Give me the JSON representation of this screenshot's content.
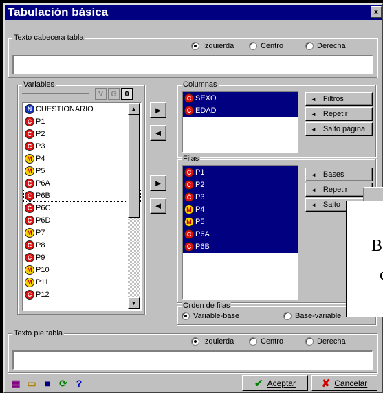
{
  "window": {
    "title": "Tabulación básica",
    "close": "x"
  },
  "header_group": {
    "label": "Texto cabecera tabla",
    "value": "",
    "align": [
      {
        "label": "Izquierda",
        "checked": true
      },
      {
        "label": "Centro",
        "checked": false
      },
      {
        "label": "Derecha",
        "checked": false
      }
    ]
  },
  "variables": {
    "label": "Variables",
    "filter_buttons": [
      {
        "label": "V",
        "active": false
      },
      {
        "label": "G",
        "active": false
      },
      {
        "label": "0",
        "active": true
      }
    ],
    "items": [
      {
        "badge": "N",
        "name": "CUESTIONARIO"
      },
      {
        "badge": "C",
        "name": "P1"
      },
      {
        "badge": "C",
        "name": "P2"
      },
      {
        "badge": "C",
        "name": "P3"
      },
      {
        "badge": "M",
        "name": "P4"
      },
      {
        "badge": "M",
        "name": "P5"
      },
      {
        "badge": "C",
        "name": "P6A"
      },
      {
        "badge": "C",
        "name": "P6B"
      },
      {
        "badge": "C",
        "name": "P6C"
      },
      {
        "badge": "C",
        "name": "P6D"
      },
      {
        "badge": "M",
        "name": "P7"
      },
      {
        "badge": "C",
        "name": "P8"
      },
      {
        "badge": "C",
        "name": "P9"
      },
      {
        "badge": "M",
        "name": "P10"
      },
      {
        "badge": "M",
        "name": "P11"
      },
      {
        "badge": "C",
        "name": "P12"
      }
    ]
  },
  "move_icons": {
    "right": "►",
    "left": "◄"
  },
  "columns": {
    "label": "Columnas",
    "items": [
      {
        "badge": "C",
        "name": "SEXO"
      },
      {
        "badge": "C",
        "name": "EDAD"
      }
    ],
    "buttons": [
      "Filtros",
      "Repetir",
      "Salto página"
    ]
  },
  "rows": {
    "label": "Filas",
    "items": [
      {
        "badge": "C",
        "name": "P1"
      },
      {
        "badge": "C",
        "name": "P2"
      },
      {
        "badge": "C",
        "name": "P3"
      },
      {
        "badge": "M",
        "name": "P4"
      },
      {
        "badge": "M",
        "name": "P5"
      },
      {
        "badge": "C",
        "name": "P6A"
      },
      {
        "badge": "C",
        "name": "P6B"
      }
    ],
    "buttons": [
      "Bases",
      "Repetir",
      "Salto"
    ]
  },
  "row_order": {
    "label": "Orden de filas",
    "options": [
      {
        "label": "Variable-base",
        "checked": true
      },
      {
        "label": "Base-variable",
        "checked": false
      }
    ]
  },
  "footer_group": {
    "label": "Texto pie tabla",
    "value": "",
    "align": [
      {
        "label": "Izquierda",
        "checked": true
      },
      {
        "label": "Centro",
        "checked": false
      },
      {
        "label": "Derecha",
        "checked": false
      }
    ]
  },
  "toolbar": {
    "accept": "Aceptar",
    "cancel": "Cancelar",
    "icons": [
      "table-settings-icon",
      "open-folder-icon",
      "save-icon",
      "refresh-icon",
      "help-icon"
    ]
  },
  "popup": {
    "lines": [
      "B",
      "c",
      ""
    ]
  },
  "colors": {
    "titlebar": "#000080",
    "face": "#c0c0c0",
    "selection": "#000080",
    "badge_c": "#e01010",
    "badge_m": "#ffd800",
    "badge_n": "#1030c0"
  }
}
